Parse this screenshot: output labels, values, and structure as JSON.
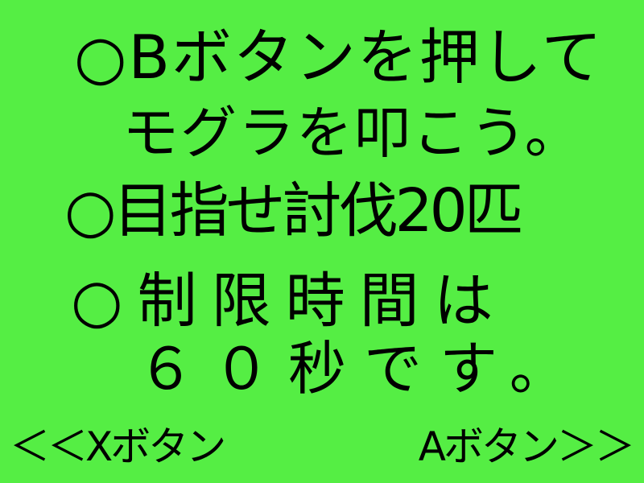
{
  "colors": {
    "background": "#55ee44",
    "text": "#000000"
  },
  "instructions": {
    "line1": "○Bボタンを押して",
    "line2": "モグラを叩こう。",
    "line3": "○目指せ討伐20匹",
    "line4": "○制限時間は",
    "line5": "６０秒です。"
  },
  "navigation": {
    "prev_label": "＜＜Xボタン",
    "next_label": "Aボタン＞＞"
  }
}
